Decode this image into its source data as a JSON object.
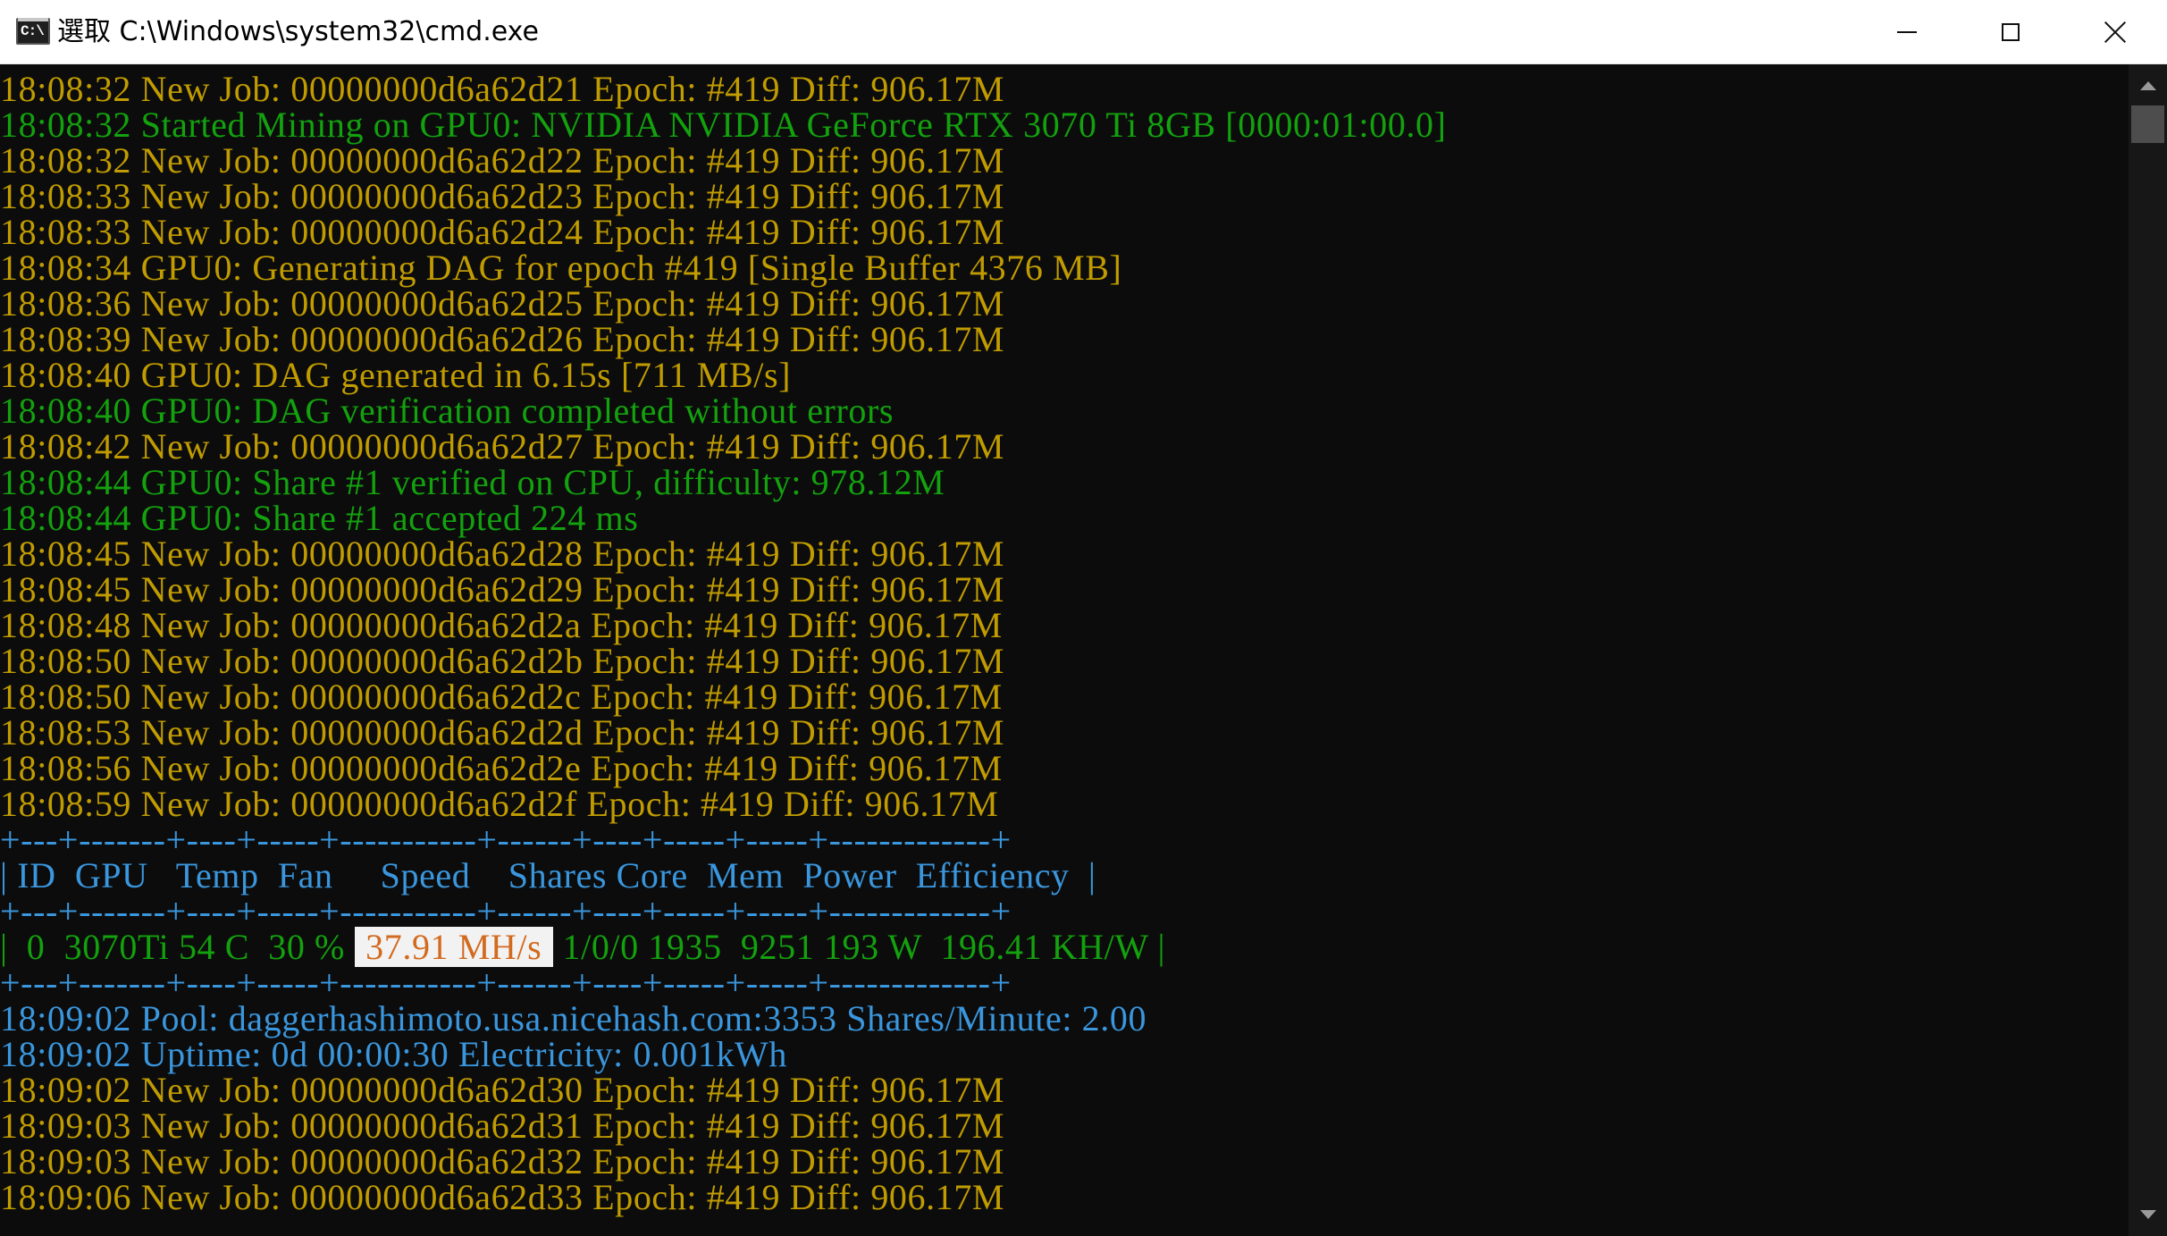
{
  "window": {
    "title": "選取 C:\\Windows\\system32\\cmd.exe",
    "icon_label": "C:\\",
    "buttons": {
      "minimize": "minimize-icon",
      "maximize": "maximize-icon",
      "close": "close-icon"
    }
  },
  "colors": {
    "background": "#0c0c0c",
    "yellow": "#c19c00",
    "green": "#13a10e",
    "blue": "#3a96dd",
    "highlight_bg": "#f2f2f2",
    "highlight_fg": "#d26a1f"
  },
  "console": {
    "lines": [
      {
        "color": "yellow",
        "text": "18:08:32 New Job: 00000000d6a62d21 Epoch: #419 Diff: 906.17M"
      },
      {
        "color": "green",
        "text": "18:08:32 Started Mining on GPU0: NVIDIA NVIDIA GeForce RTX 3070 Ti 8GB [0000:01:00.0]"
      },
      {
        "color": "yellow",
        "text": "18:08:32 New Job: 00000000d6a62d22 Epoch: #419 Diff: 906.17M"
      },
      {
        "color": "yellow",
        "text": "18:08:33 New Job: 00000000d6a62d23 Epoch: #419 Diff: 906.17M"
      },
      {
        "color": "yellow",
        "text": "18:08:33 New Job: 00000000d6a62d24 Epoch: #419 Diff: 906.17M"
      },
      {
        "color": "yellow",
        "text": "18:08:34 GPU0: Generating DAG for epoch #419 [Single Buffer 4376 MB]"
      },
      {
        "color": "yellow",
        "text": "18:08:36 New Job: 00000000d6a62d25 Epoch: #419 Diff: 906.17M"
      },
      {
        "color": "yellow",
        "text": "18:08:39 New Job: 00000000d6a62d26 Epoch: #419 Diff: 906.17M"
      },
      {
        "color": "yellow",
        "text": "18:08:40 GPU0: DAG generated in 6.15s [711 MB/s]"
      },
      {
        "color": "green",
        "text": "18:08:40 GPU0: DAG verification completed without errors"
      },
      {
        "color": "yellow",
        "text": "18:08:42 New Job: 00000000d6a62d27 Epoch: #419 Diff: 906.17M"
      },
      {
        "color": "green",
        "text": "18:08:44 GPU0: Share #1 verified on CPU, difficulty: 978.12M"
      },
      {
        "color": "green",
        "text": "18:08:44 GPU0: Share #1 accepted 224 ms"
      },
      {
        "color": "yellow",
        "text": "18:08:45 New Job: 00000000d6a62d28 Epoch: #419 Diff: 906.17M"
      },
      {
        "color": "yellow",
        "text": "18:08:45 New Job: 00000000d6a62d29 Epoch: #419 Diff: 906.17M"
      },
      {
        "color": "yellow",
        "text": "18:08:48 New Job: 00000000d6a62d2a Epoch: #419 Diff: 906.17M"
      },
      {
        "color": "yellow",
        "text": "18:08:50 New Job: 00000000d6a62d2b Epoch: #419 Diff: 906.17M"
      },
      {
        "color": "yellow",
        "text": "18:08:50 New Job: 00000000d6a62d2c Epoch: #419 Diff: 906.17M"
      },
      {
        "color": "yellow",
        "text": "18:08:53 New Job: 00000000d6a62d2d Epoch: #419 Diff: 906.17M"
      },
      {
        "color": "yellow",
        "text": "18:08:56 New Job: 00000000d6a62d2e Epoch: #419 Diff: 906.17M"
      },
      {
        "color": "yellow",
        "text": "18:08:59 New Job: 00000000d6a62d2f Epoch: #419 Diff: 906.17M"
      }
    ],
    "table": {
      "border": "+---+-------+----+-----+-----------+------+----+-----+-----+-------------+",
      "header": "| ID  GPU   Temp  Fan     Speed    Shares Core  Mem  Power  Efficiency  |",
      "row": {
        "pre": "|  0  3070Ti 54 C  30 % ",
        "speed": " 37.91 MH/s ",
        "post": " 1/0/0 1935  9251 193 W  196.41 KH/W |"
      }
    },
    "after_lines": [
      {
        "color": "blue",
        "text": "18:09:02 Pool: daggerhashimoto.usa.nicehash.com:3353 Shares/Minute: 2.00"
      },
      {
        "color": "blue",
        "text": "18:09:02 Uptime: 0d 00:00:30 Electricity: 0.001kWh"
      },
      {
        "color": "yellow",
        "text": "18:09:02 New Job: 00000000d6a62d30 Epoch: #419 Diff: 906.17M"
      },
      {
        "color": "yellow",
        "text": "18:09:03 New Job: 00000000d6a62d31 Epoch: #419 Diff: 906.17M"
      },
      {
        "color": "yellow",
        "text": "18:09:03 New Job: 00000000d6a62d32 Epoch: #419 Diff: 906.17M"
      },
      {
        "color": "yellow",
        "text": "18:09:06 New Job: 00000000d6a62d33 Epoch: #419 Diff: 906.17M"
      }
    ]
  },
  "scrollbar": {
    "up_icon": "arrow-up-icon",
    "down_icon": "arrow-down-icon"
  }
}
